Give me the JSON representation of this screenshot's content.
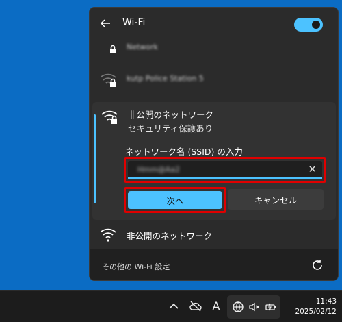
{
  "header": {
    "title": "Wi-Fi",
    "wifi_on": true
  },
  "networks": [
    {
      "name": "Network"
    },
    {
      "name": "kutp Police Station 5"
    }
  ],
  "hidden_expanded": {
    "title": "非公開のネットワーク",
    "security": "セキュリティ保護あり",
    "ssid_label": "ネットワーク名 (SSID) の入力",
    "ssid_value": "Hmm@Aa2",
    "clear_glyph": "✕",
    "next_label": "次へ",
    "cancel_label": "キャンセル"
  },
  "hidden_item": {
    "name": "非公開のネットワーク"
  },
  "footer": {
    "settings_link": "その他の Wi-Fi 設定"
  },
  "taskbar": {
    "ime_indicator": "A",
    "time": "11:43",
    "date": "2025/02/12"
  },
  "colors": {
    "accent": "#4cc2ff",
    "highlight": "#e00000"
  }
}
